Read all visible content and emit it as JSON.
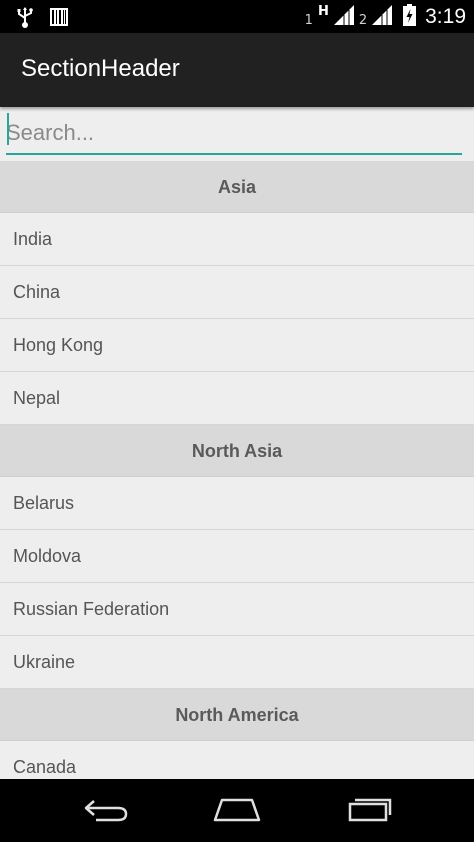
{
  "status_bar": {
    "sim1": "1",
    "network_type": "H",
    "sim2": "2",
    "time": "3:19",
    "icons": [
      "usb-icon",
      "barcode-icon",
      "signal-icon",
      "battery-charging-icon"
    ]
  },
  "action_bar": {
    "title": "SectionHeader"
  },
  "search": {
    "placeholder": "Search...",
    "value": ""
  },
  "list": {
    "sections": [
      {
        "header": "Asia",
        "items": [
          "India",
          "China",
          "Hong Kong",
          "Nepal"
        ]
      },
      {
        "header": "North Asia",
        "items": [
          "Belarus",
          "Moldova",
          "Russian Federation",
          "Ukraine"
        ]
      },
      {
        "header": "North America",
        "items": [
          "Canada"
        ]
      }
    ]
  },
  "nav_bar": {
    "buttons": [
      "back-icon",
      "home-icon",
      "recents-icon"
    ]
  },
  "colors": {
    "accent": "#26a69a",
    "action_bar": "#212121",
    "section_header_bg": "#d9d9d9",
    "list_bg": "#eeeeee"
  }
}
